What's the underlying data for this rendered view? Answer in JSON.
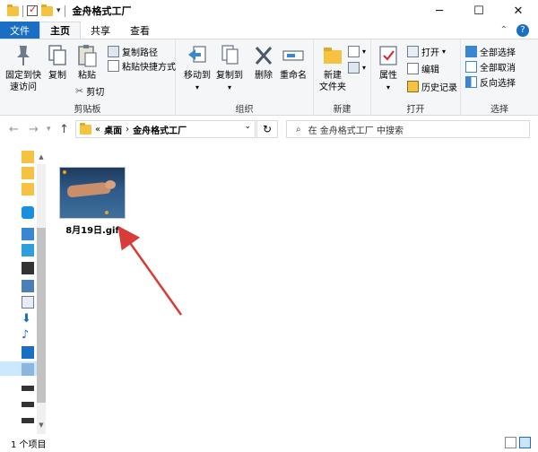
{
  "window": {
    "title": "金舟格式工厂",
    "minimize": "─",
    "maximize": "☐",
    "close": "✕"
  },
  "tabs": {
    "file": "文件",
    "home": "主页",
    "share": "共享",
    "view": "查看"
  },
  "ribbon": {
    "clipboard": {
      "label": "剪贴板",
      "pin": "固定到快\n速访问",
      "copy": "复制",
      "paste": "粘贴",
      "copy_path": "复制路径",
      "paste_shortcut": "粘贴快捷方式",
      "cut": "剪切"
    },
    "organize": {
      "label": "组织",
      "move_to": "移动到",
      "copy_to": "复制到",
      "delete": "删除",
      "rename": "重命名"
    },
    "new": {
      "label": "新建",
      "new_folder": "新建\n文件夹"
    },
    "open": {
      "label": "打开",
      "properties": "属性",
      "open": "打开",
      "edit": "编辑",
      "history": "历史记录"
    },
    "select": {
      "label": "选择",
      "select_all": "全部选择",
      "select_none": "全部取消",
      "invert": "反向选择"
    }
  },
  "address": {
    "prefix": "«",
    "path1": "桌面",
    "separator": "›",
    "path2": "金舟格式工厂",
    "search_placeholder": "在 金舟格式工厂 中搜索"
  },
  "files": [
    {
      "name": "8月19日.gif"
    }
  ],
  "status": {
    "count": "1 个项目"
  },
  "colors": {
    "accent": "#1a6fc4",
    "arrow": "#d93a3a"
  }
}
